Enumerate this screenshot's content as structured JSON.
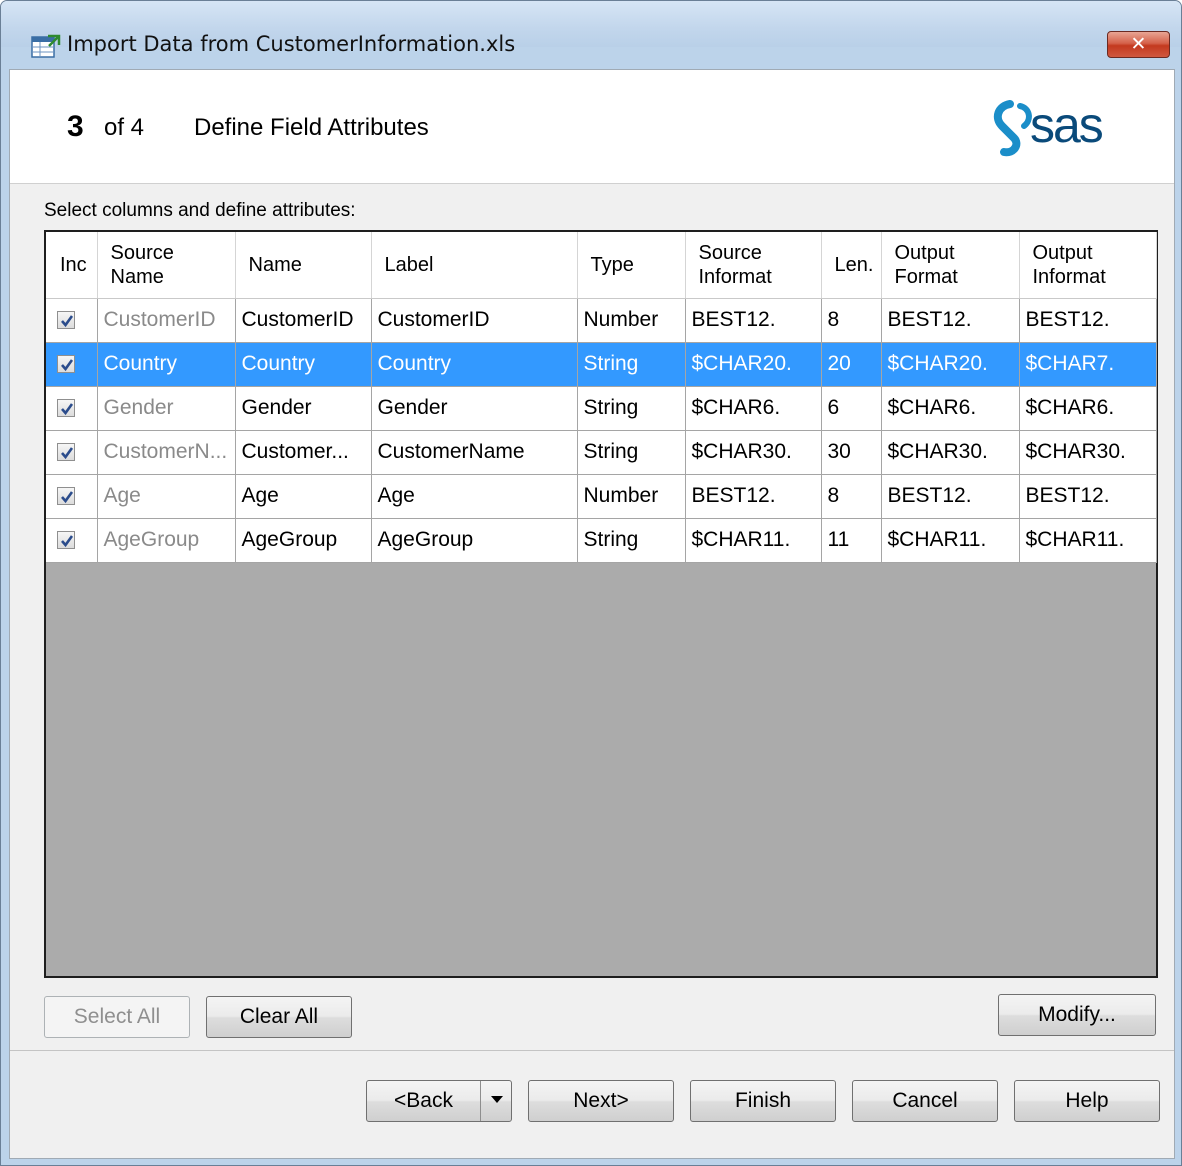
{
  "window": {
    "title": "Import Data from CustomerInformation.xls",
    "close_label": "✕"
  },
  "header": {
    "step_number": "3",
    "step_of": "of 4",
    "step_title": "Define Field Attributes",
    "logo_text": "sas"
  },
  "instructions": "Select columns and define attributes:",
  "table": {
    "columns": [
      {
        "key": "inc",
        "label": "Inc"
      },
      {
        "key": "source_name",
        "label": "Source Name"
      },
      {
        "key": "name",
        "label": "Name"
      },
      {
        "key": "label",
        "label": "Label"
      },
      {
        "key": "type",
        "label": "Type"
      },
      {
        "key": "source_informat",
        "label": "Source Informat"
      },
      {
        "key": "len",
        "label": "Len."
      },
      {
        "key": "output_format",
        "label": "Output Format"
      },
      {
        "key": "output_informat",
        "label": "Output Informat"
      }
    ],
    "rows": [
      {
        "inc": true,
        "source_name": "CustomerID",
        "name": "CustomerID",
        "label": "CustomerID",
        "type": "Number",
        "source_informat": "BEST12.",
        "len": "8",
        "output_format": "BEST12.",
        "output_informat": "BEST12.",
        "selected": false
      },
      {
        "inc": true,
        "source_name": "Country",
        "name": "Country",
        "label": "Country",
        "type": "String",
        "source_informat": "$CHAR20.",
        "len": "20",
        "output_format": "$CHAR20.",
        "output_informat": "$CHAR7.",
        "selected": true
      },
      {
        "inc": true,
        "source_name": "Gender",
        "name": "Gender",
        "label": "Gender",
        "type": "String",
        "source_informat": "$CHAR6.",
        "len": "6",
        "output_format": "$CHAR6.",
        "output_informat": "$CHAR6.",
        "selected": false
      },
      {
        "inc": true,
        "source_name": "CustomerN...",
        "name": "Customer...",
        "label": "CustomerName",
        "type": "String",
        "source_informat": "$CHAR30.",
        "len": "30",
        "output_format": "$CHAR30.",
        "output_informat": "$CHAR30.",
        "selected": false
      },
      {
        "inc": true,
        "source_name": "Age",
        "name": "Age",
        "label": "Age",
        "type": "Number",
        "source_informat": "BEST12.",
        "len": "8",
        "output_format": "BEST12.",
        "output_informat": "BEST12.",
        "selected": false
      },
      {
        "inc": true,
        "source_name": "AgeGroup",
        "name": "AgeGroup",
        "label": "AgeGroup",
        "type": "String",
        "source_informat": "$CHAR11.",
        "len": "11",
        "output_format": "$CHAR11.",
        "output_informat": "$CHAR11.",
        "selected": false
      }
    ]
  },
  "grid_buttons": {
    "select_all": "Select All",
    "clear_all": "Clear All",
    "modify": "Modify..."
  },
  "footer_buttons": {
    "back": "<Back",
    "next": "Next>",
    "finish": "Finish",
    "cancel": "Cancel",
    "help": "Help"
  },
  "colors": {
    "selection": "#3399ff",
    "grid_background": "#ababab",
    "dialog_background": "#f0f0f0"
  }
}
